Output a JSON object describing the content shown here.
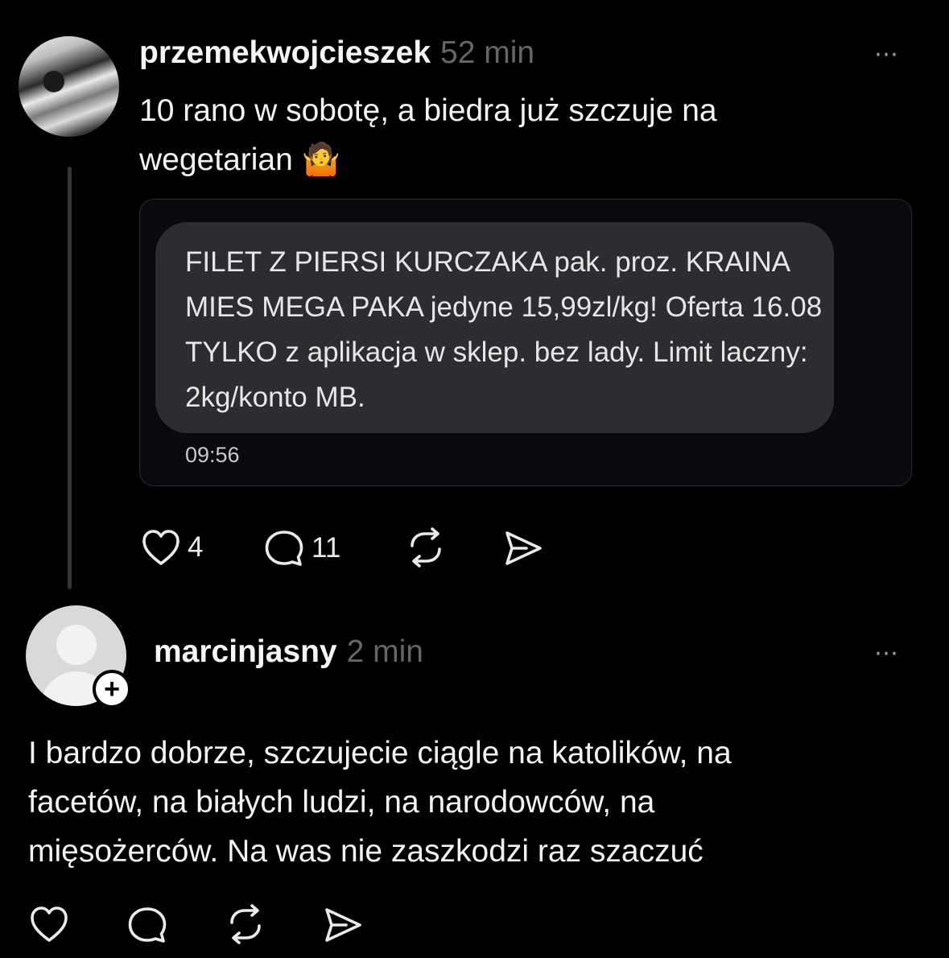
{
  "post1": {
    "username": "przemekwojcieszek",
    "time_ago": "52 min",
    "more_icon": "⋯",
    "text": "10 rano w sobotę, a biedra już szczuje na wegetarian 🤷",
    "sms": {
      "text": "FILET Z PIERSI KURCZAKA pak. proz. KRAINA MIES MEGA PAKA jedyne 15,99zl/kg! Oferta 16.08 TYLKO z aplikacja w sklep. bez lady. Limit laczny: 2kg/konto MB.",
      "time": "09:56"
    },
    "likes": "4",
    "comments": "11"
  },
  "post2": {
    "username": "marcinjasny",
    "time_ago": "2 min",
    "more_icon": "⋯",
    "follow_icon": "+",
    "text": "I bardzo dobrze, szczujecie ciągle na katolików, na facetów, na białych ludzi, na narodowców, na mięsożerców. Na was nie zaszkodzi raz szaczuć"
  },
  "colors": {
    "background": "#000000",
    "muted": "#666666",
    "bubble": "#2c2d31",
    "card_border": "#2a2a2a"
  }
}
